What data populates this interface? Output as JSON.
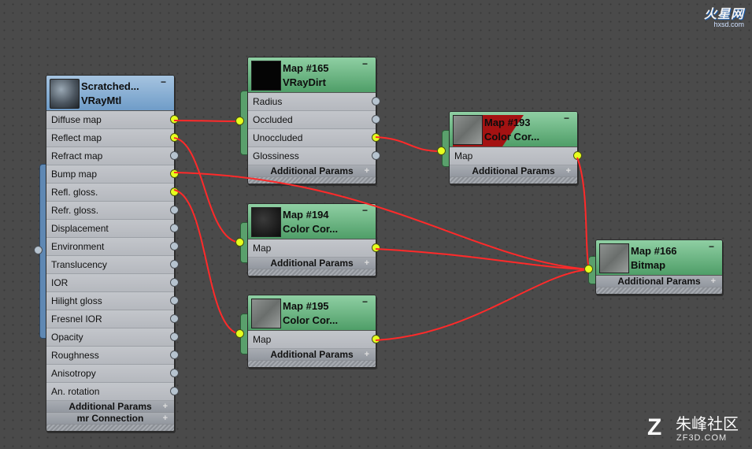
{
  "watermarks": {
    "top_right_brand": "火星网",
    "top_right_site": "hxsd.com",
    "bottom_right_mark": "Z",
    "bottom_right_brand": "朱峰社区",
    "bottom_right_site": "ZF3D.COM"
  },
  "nodes": {
    "vraymtl": {
      "title": "Scratched...",
      "type": "VRayMtl",
      "collapse": "−",
      "slots": [
        "Diffuse map",
        "Reflect map",
        "Refract map",
        "Bump map",
        "Refl. gloss.",
        "Refr. gloss.",
        "Displacement",
        "Environment",
        "Translucency",
        "IOR",
        "Hilight gloss",
        "Fresnel IOR",
        "Opacity",
        "Roughness",
        "Anisotropy",
        "An. rotation"
      ],
      "rollouts": [
        "Additional Params",
        "mr Connection"
      ],
      "plus": "+"
    },
    "map165": {
      "title": "Map #165",
      "type": "VRayDirt",
      "collapse": "−",
      "slots": [
        "Radius",
        "Occluded",
        "Unoccluded",
        "Glossiness"
      ],
      "rollout": "Additional Params",
      "plus": "+"
    },
    "map193": {
      "title": "Map #193",
      "type": "Color Cor...",
      "collapse": "−",
      "slots": [
        "Map"
      ],
      "rollout": "Additional Params",
      "plus": "+"
    },
    "map194": {
      "title": "Map #194",
      "type": "Color Cor...",
      "collapse": "−",
      "slots": [
        "Map"
      ],
      "rollout": "Additional Params",
      "plus": "+"
    },
    "map195": {
      "title": "Map #195",
      "type": "Color Cor...",
      "collapse": "−",
      "slots": [
        "Map"
      ],
      "rollout": "Additional Params",
      "plus": "+"
    },
    "map166": {
      "title": "Map #166",
      "type": "Bitmap",
      "collapse": "−",
      "rollout": "Additional Params",
      "plus": "+"
    }
  },
  "colors": {
    "wire": "#ff2a2a",
    "socket_connected": "#e6ff1e",
    "socket_empty": "#b6c3cf",
    "material_header": "#6f9cc8",
    "map_header": "#4f9e68"
  }
}
